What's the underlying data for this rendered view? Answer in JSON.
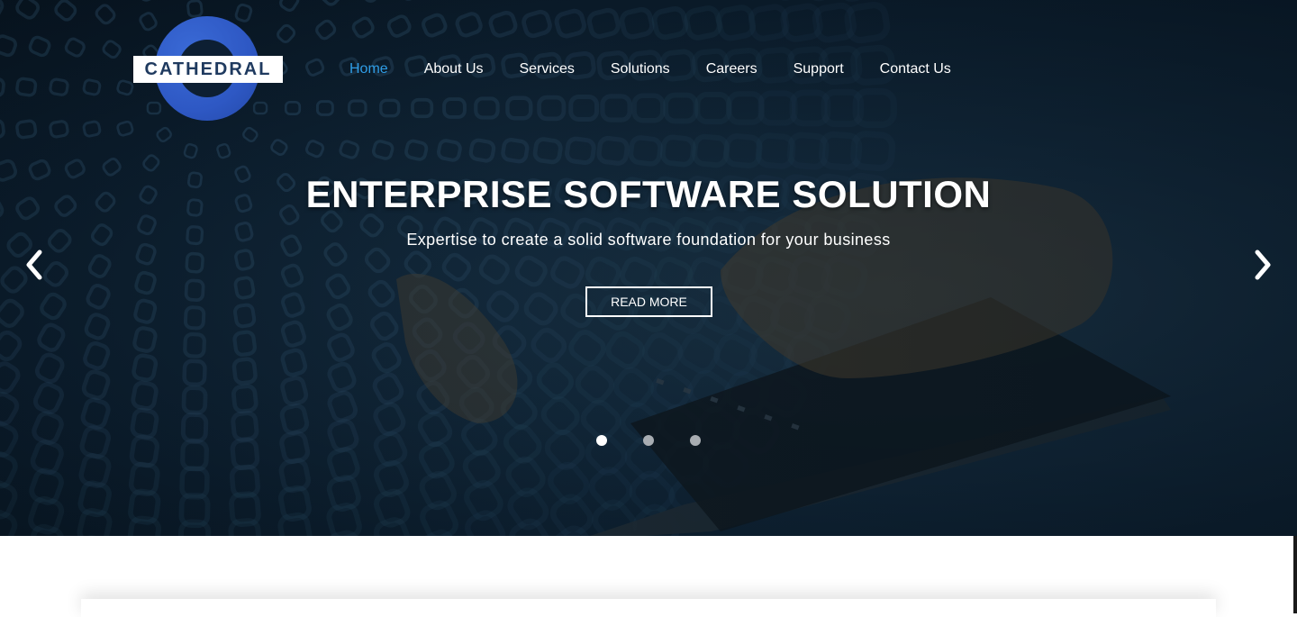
{
  "brand": {
    "name": "CATHEDRAL",
    "colors": {
      "logo_blue": "#2e58c4",
      "nav_active": "#2f9de6",
      "hero_bg": "#12283a"
    }
  },
  "nav": {
    "items": [
      {
        "label": "Home",
        "active": true
      },
      {
        "label": "About Us"
      },
      {
        "label": "Services"
      },
      {
        "label": "Solutions"
      },
      {
        "label": "Careers"
      },
      {
        "label": "Support"
      },
      {
        "label": "Contact Us"
      }
    ]
  },
  "hero": {
    "headline": "ENTERPRISE SOFTWARE SOLUTION",
    "subline": "Expertise to create a solid software foundation for your business",
    "cta_label": "READ MORE",
    "prev_icon": "chevron-left-icon",
    "next_icon": "chevron-right-icon",
    "slides": {
      "count": 3,
      "active_index": 0
    }
  }
}
